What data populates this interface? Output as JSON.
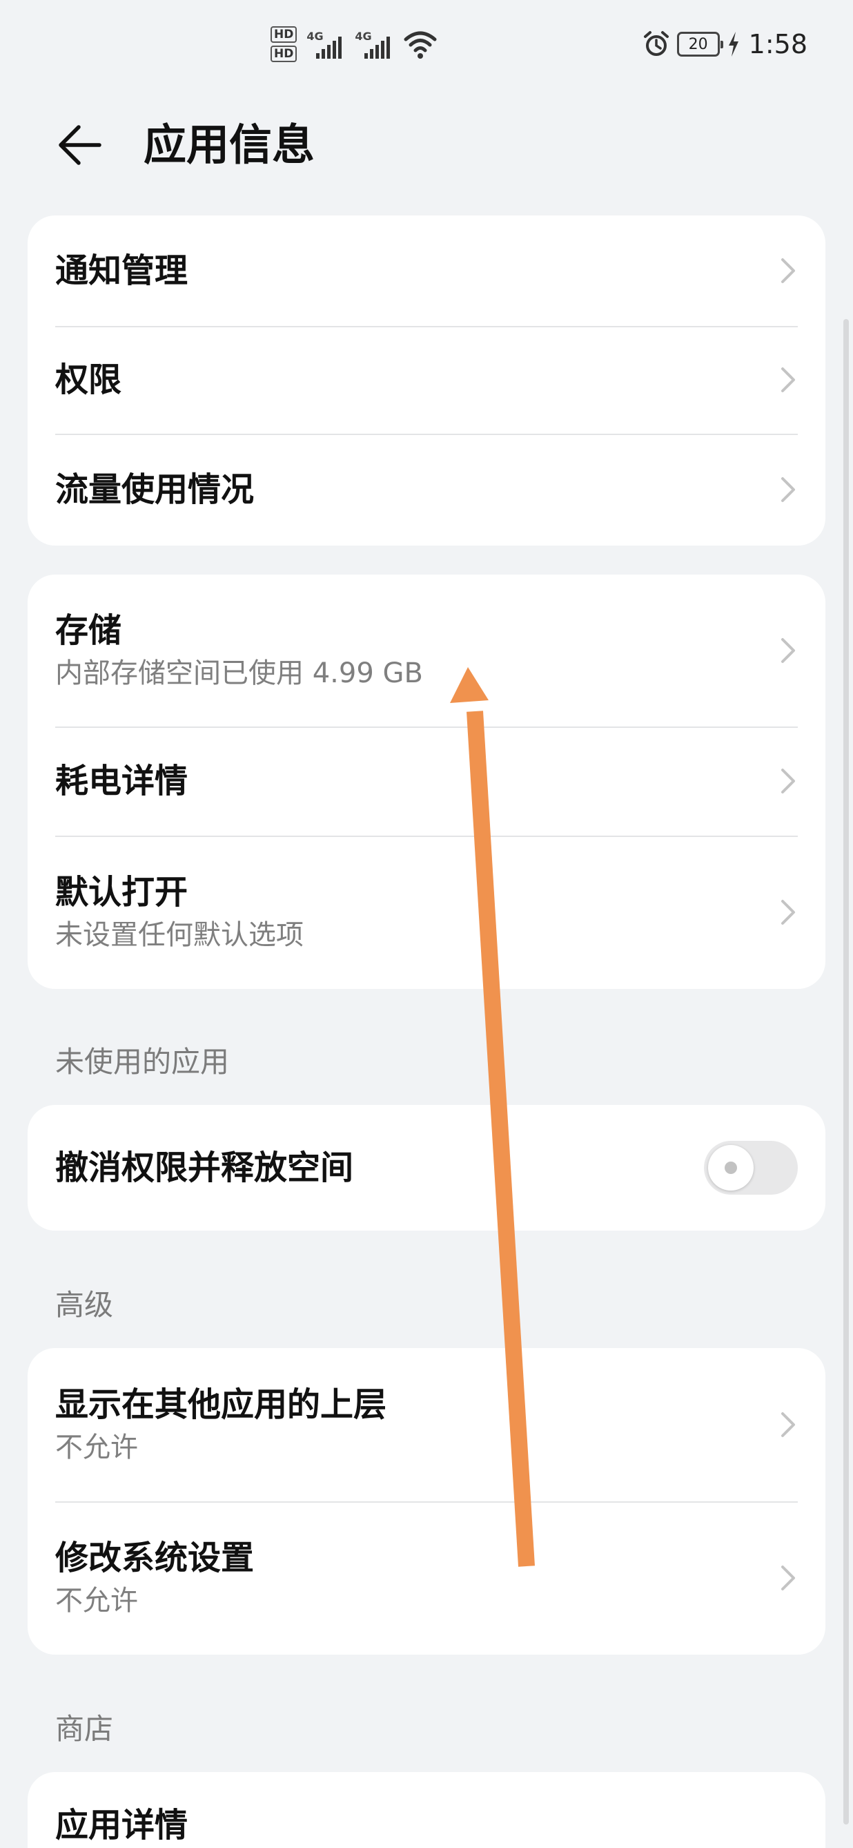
{
  "status_bar": {
    "sim1": "HD",
    "sim2": "HD",
    "net1": "4G",
    "net2": "4G",
    "battery": "20",
    "time": "1:58",
    "icons": [
      "alarm-icon",
      "wifi-icon",
      "charging-bolt-icon",
      "signal-bars-icon"
    ]
  },
  "header": {
    "back_icon": "back-arrow-icon",
    "title": "应用信息"
  },
  "group1": {
    "items": [
      {
        "title": "通知管理"
      },
      {
        "title": "权限"
      },
      {
        "title": "流量使用情况"
      }
    ]
  },
  "group2": {
    "items": [
      {
        "title": "存储",
        "subtitle": "内部存储空间已使用 4.99 GB"
      },
      {
        "title": "耗电详情"
      },
      {
        "title": "默认打开",
        "subtitle": "未设置任何默认选项"
      }
    ]
  },
  "unused_section": {
    "label": "未使用的应用",
    "toggle_item": {
      "title": "撤消权限并释放空间",
      "enabled": false
    }
  },
  "advanced_section": {
    "label": "高级",
    "items": [
      {
        "title": "显示在其他应用的上层",
        "subtitle": "不允许"
      },
      {
        "title": "修改系统设置",
        "subtitle": "不允许"
      }
    ]
  },
  "store_section": {
    "label": "商店",
    "items": [
      {
        "title": "应用详情"
      }
    ]
  },
  "gesture": {
    "type": "swipe-up",
    "color": "#f0924e"
  },
  "colors": {
    "background": "#f1f3f5",
    "card": "#ffffff",
    "secondary_text": "#7f7f7f",
    "chevron": "#c4c4c4"
  }
}
